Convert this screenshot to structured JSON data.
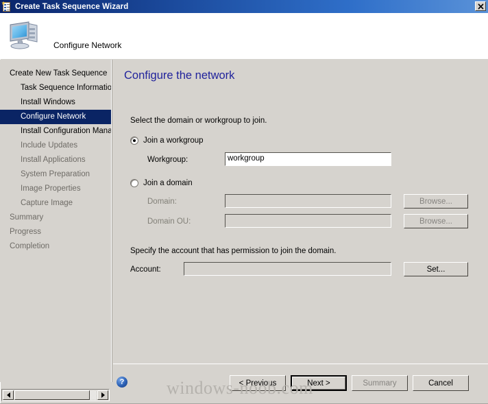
{
  "window": {
    "title": "Create Task Sequence Wizard",
    "icon": "task-sequence-clipboard-icon",
    "close_label": "✕"
  },
  "header": {
    "title": "Configure Network",
    "icon": "computer-monitor-icon"
  },
  "sidebar": {
    "items": [
      {
        "label": "Create New Task Sequence",
        "level": 0,
        "state": "normal"
      },
      {
        "label": "Task Sequence Information",
        "level": 1,
        "state": "normal"
      },
      {
        "label": "Install Windows",
        "level": 1,
        "state": "normal"
      },
      {
        "label": "Configure Network",
        "level": 1,
        "state": "selected"
      },
      {
        "label": "Install Configuration Manager",
        "level": 1,
        "state": "normal"
      },
      {
        "label": "Include Updates",
        "level": 1,
        "state": "dim"
      },
      {
        "label": "Install Applications",
        "level": 1,
        "state": "dim"
      },
      {
        "label": "System Preparation",
        "level": 1,
        "state": "dim"
      },
      {
        "label": "Image Properties",
        "level": 1,
        "state": "dim"
      },
      {
        "label": "Capture Image",
        "level": 1,
        "state": "dim"
      },
      {
        "label": "Summary",
        "level": 0,
        "state": "dim"
      },
      {
        "label": "Progress",
        "level": 0,
        "state": "dim"
      },
      {
        "label": "Completion",
        "level": 0,
        "state": "dim"
      }
    ]
  },
  "main": {
    "page_title": "Configure the network",
    "intro_text": "Select the domain or workgroup to join.",
    "workgroup_radio": {
      "label": "Join a workgroup",
      "checked": true
    },
    "workgroup_field": {
      "label": "Workgroup:",
      "value": "workgroup",
      "placeholder": "",
      "enabled": true
    },
    "domain_radio": {
      "label": "Join a domain",
      "checked": false
    },
    "domain_field": {
      "label": "Domain:",
      "value": "",
      "enabled": false
    },
    "domain_browse_button": {
      "label": "Browse...",
      "enabled": false
    },
    "domain_ou_field": {
      "label": "Domain OU:",
      "value": "",
      "enabled": false
    },
    "domain_ou_browse_button": {
      "label": "Browse...",
      "enabled": false
    },
    "account_text": "Specify the account that has permission to join the domain.",
    "account_field": {
      "label": "Account:",
      "value": "",
      "enabled": true
    },
    "account_set_button": {
      "label": "Set...",
      "enabled": true
    }
  },
  "footer": {
    "help_icon": "question-mark-icon",
    "help_glyph": "?",
    "buttons": [
      {
        "label": "< Previous",
        "state": "normal"
      },
      {
        "label": "Next >",
        "state": "default"
      },
      {
        "label": "Summary",
        "state": "disabled"
      },
      {
        "label": "Cancel",
        "state": "normal"
      }
    ]
  },
  "watermark": {
    "text": "windows-noob.com"
  },
  "scrollbar": {
    "left_arrow": "◀",
    "right_arrow": "▶"
  },
  "colors": {
    "title_bar_start": "#0a246a",
    "title_bar_end": "#5a92d8",
    "window_face": "#d6d3ce",
    "selection": "#0a2464",
    "page_title": "#21239c",
    "disabled_text": "#828078",
    "watermark": "#b5b2ad"
  }
}
